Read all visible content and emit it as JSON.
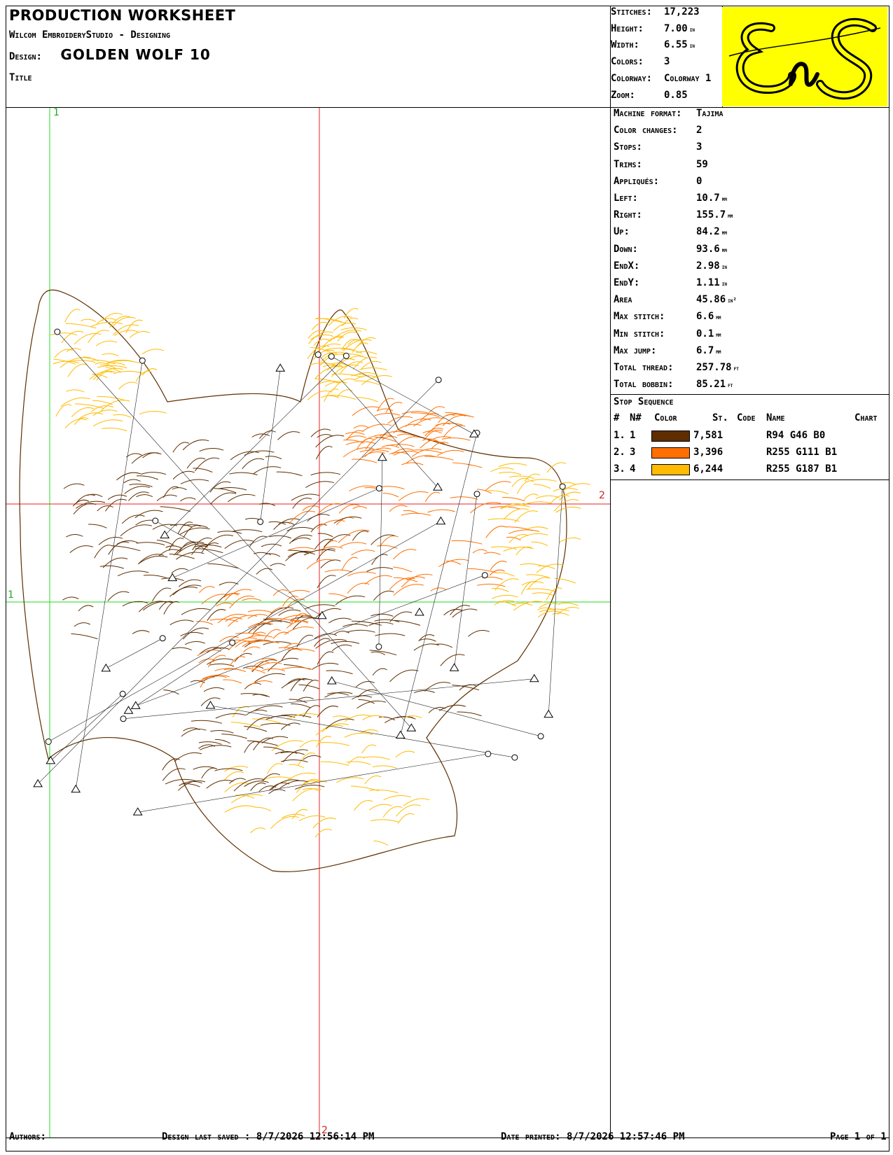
{
  "header": {
    "title": "PRODUCTION WORKSHEET",
    "software": "Wilcom EmbroideryStudio - Designing",
    "design_label": "Design:",
    "design_name": "GOLDEN WOLF  10",
    "title_label": "Title"
  },
  "summary": [
    {
      "key": "Stitches:",
      "value": "17,223",
      "unit": ""
    },
    {
      "key": "Height:",
      "value": "7.00",
      "unit": "in"
    },
    {
      "key": "Width:",
      "value": "6.55",
      "unit": "in"
    },
    {
      "key": "Colors:",
      "value": "3",
      "unit": ""
    },
    {
      "key": "Colorway:",
      "value": "Colorway 1",
      "unit": ""
    },
    {
      "key": "Zoom:",
      "value": "0.85",
      "unit": ""
    }
  ],
  "logo": {
    "text": "EnS",
    "bg": "#ffff00"
  },
  "details": [
    {
      "key": "Machine format:",
      "value": "Tajima",
      "unit": ""
    },
    {
      "key": "Color changes:",
      "value": "2",
      "unit": ""
    },
    {
      "key": "Stops:",
      "value": "3",
      "unit": ""
    },
    {
      "key": "Trims:",
      "value": "59",
      "unit": ""
    },
    {
      "key": "Appliqués:",
      "value": "0",
      "unit": ""
    },
    {
      "key": "Left:",
      "value": "10.7",
      "unit": "mm"
    },
    {
      "key": "Right:",
      "value": "155.7",
      "unit": "mm"
    },
    {
      "key": "Up:",
      "value": "84.2",
      "unit": "mm"
    },
    {
      "key": "Down:",
      "value": "93.6",
      "unit": "mm"
    },
    {
      "key": "EndX:",
      "value": "2.98",
      "unit": "in"
    },
    {
      "key": "EndY:",
      "value": "1.11",
      "unit": "in"
    },
    {
      "key": "Area",
      "value": "45.86",
      "unit": "in²"
    },
    {
      "key": "Max stitch:",
      "value": "6.6",
      "unit": "mm"
    },
    {
      "key": "Min stitch:",
      "value": "0.1",
      "unit": "mm"
    },
    {
      "key": "Max jump:",
      "value": "6.7",
      "unit": "mm"
    },
    {
      "key": "Total thread:",
      "value": "257.78",
      "unit": "ft"
    },
    {
      "key": "Total bobbin:",
      "value": "85.21",
      "unit": "ft"
    }
  ],
  "stop_sequence": {
    "title": "Stop Sequence",
    "headers": {
      "num": "#",
      "n": "N#",
      "color": "Color",
      "st": "St.",
      "code": "Code",
      "name": "Name",
      "chart": "Chart"
    },
    "rows": [
      {
        "num": "1.",
        "n": "1",
        "color": "#5e2e00",
        "st": "7,581",
        "name": "R94 G46 B0"
      },
      {
        "num": "2.",
        "n": "3",
        "color": "#ff6f01",
        "st": "3,396",
        "name": "R255 G111 B1"
      },
      {
        "num": "3.",
        "n": "4",
        "color": "#ffbb01",
        "st": "6,244",
        "name": "R255 G187 B1"
      }
    ]
  },
  "canvas": {
    "axis_green_label_x": "1",
    "axis_green_label_y": "1",
    "axis_red_label_x": "2",
    "axis_red_label_y": "2"
  },
  "footer": {
    "authors": "Authors:",
    "last_saved_label": "Design last saved :",
    "last_saved": "8/7/2026 12:56:14 PM",
    "printed_label": "Date printed:",
    "printed": "8/7/2026 12:57:46 PM",
    "page": "Page 1 of 1"
  }
}
